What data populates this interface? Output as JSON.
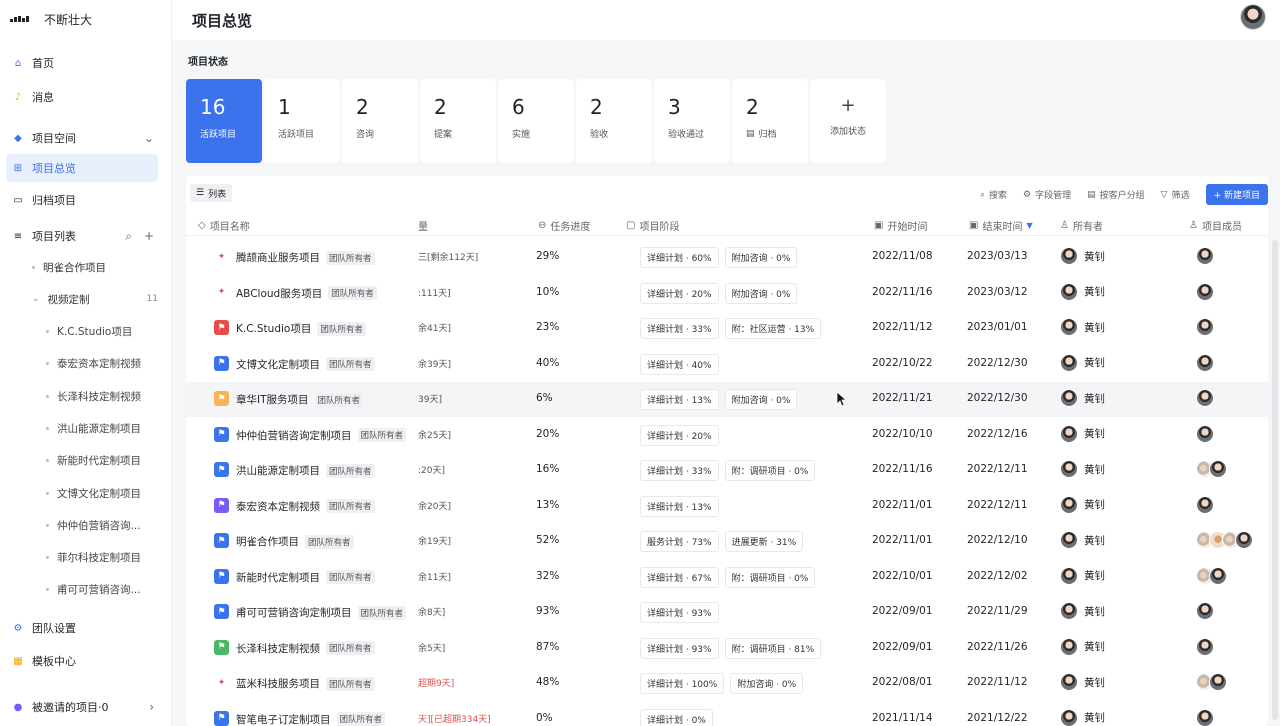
{
  "brand": {
    "name": "不断壮大"
  },
  "header": {
    "title": "项目总览"
  },
  "sidebar": {
    "home": "首页",
    "messages": "消息",
    "space": "项目空间",
    "overview": "项目总览",
    "archived": "归档项目",
    "list": "项目列表",
    "sub_items": [
      {
        "label": "明雀合作项目"
      },
      {
        "label": "视频定制",
        "count": "11"
      }
    ],
    "sub_sub_items": [
      "K.C.Studio项目",
      "泰宏资本定制视频",
      "长泽科技定制视频",
      "洪山能源定制项目",
      "新能时代定制项目",
      "文博文化定制项目",
      "仲仲伯营销咨询...",
      "菲尔科技定制项目",
      "甫可可营销咨询..."
    ],
    "team_settings": "团队设置",
    "templates": "模板中心",
    "invited": "被邀请的项目·0"
  },
  "status": {
    "title": "项目状态",
    "cards": [
      {
        "num": "16",
        "label": "活跃项目"
      },
      {
        "num": "1",
        "label": "活跃项目"
      },
      {
        "num": "2",
        "label": "咨询"
      },
      {
        "num": "2",
        "label": "提案"
      },
      {
        "num": "6",
        "label": "实施"
      },
      {
        "num": "2",
        "label": "验收"
      },
      {
        "num": "3",
        "label": "验收通过"
      },
      {
        "num": "2",
        "label": "归档"
      },
      {
        "num": "+",
        "label": "添加状态"
      }
    ]
  },
  "toolbar": {
    "list_tab": "列表",
    "search": "搜索",
    "fields": "字段管理",
    "group": "按客户分组",
    "filter": "筛选",
    "new": "+ 新建项目"
  },
  "table": {
    "headers": {
      "name": "项目名称",
      "remaining": "量",
      "progress": "任务进度",
      "phase": "项目阶段",
      "start": "开始时间",
      "end": "结束时间",
      "owner": "所有者",
      "members": "项目成员"
    },
    "tag": "团队所有者",
    "owner_name": "黄钊",
    "rows": [
      {
        "flag": "pin",
        "name": "腾颉商业服务项目",
        "remaining": "三[剩余112天]",
        "progress": "29%",
        "phases": [
          "详细计划 · 60%",
          "附加咨询 · 0%"
        ],
        "start": "2022/11/08",
        "end": "2023/03/13",
        "members": 1
      },
      {
        "flag": "pin",
        "name": "ABCloud服务项目",
        "remaining": ":111天]",
        "progress": "10%",
        "phases": [
          "详细计划 · 20%",
          "附加咨询 · 0%"
        ],
        "start": "2022/11/16",
        "end": "2023/03/12",
        "members": 1
      },
      {
        "flag": "red",
        "name": "K.C.Studio项目",
        "remaining": "余41天]",
        "progress": "23%",
        "phases": [
          "详细计划 · 33%",
          "附：社区运营 · 13%"
        ],
        "start": "2022/11/12",
        "end": "2023/01/01",
        "members": 1
      },
      {
        "flag": "blue",
        "name": "文博文化定制项目",
        "remaining": "余39天]",
        "progress": "40%",
        "phases": [
          "详细计划 · 40%"
        ],
        "start": "2022/10/22",
        "end": "2022/12/30",
        "members": 1
      },
      {
        "flag": "orange",
        "name": "章华IT服务项目",
        "remaining": "39天]",
        "progress": "6%",
        "phases": [
          "详细计划 · 13%",
          "附加咨询 · 0%"
        ],
        "start": "2022/11/21",
        "end": "2022/12/30",
        "members": 1
      },
      {
        "flag": "blue",
        "name": "仲仲伯营销咨询定制项目",
        "remaining": "余25天]",
        "progress": "20%",
        "phases": [
          "详细计划 · 20%"
        ],
        "start": "2022/10/10",
        "end": "2022/12/16",
        "members": 1
      },
      {
        "flag": "blue",
        "name": "洪山能源定制项目",
        "remaining": ":20天]",
        "progress": "16%",
        "phases": [
          "详细计划 · 33%",
          "附：调研项目 · 0%"
        ],
        "start": "2022/11/16",
        "end": "2022/12/11",
        "members": 2
      },
      {
        "flag": "purple",
        "name": "泰宏资本定制视频",
        "remaining": "余20天]",
        "progress": "13%",
        "phases": [
          "详细计划 · 13%"
        ],
        "start": "2022/11/01",
        "end": "2022/12/11",
        "members": 1
      },
      {
        "flag": "blue",
        "name": "明雀合作项目",
        "remaining": "余19天]",
        "progress": "52%",
        "phases": [
          "服务计划 · 73%",
          "进展更新 · 31%"
        ],
        "start": "2022/11/01",
        "end": "2022/12/10",
        "members": 4
      },
      {
        "flag": "blue",
        "name": "新能时代定制项目",
        "remaining": "余11天]",
        "progress": "32%",
        "phases": [
          "详细计划 · 67%",
          "附：调研项目 · 0%"
        ],
        "start": "2022/10/01",
        "end": "2022/12/02",
        "members": 2
      },
      {
        "flag": "blue",
        "name": "甫可可营销咨询定制项目",
        "remaining": "余8天]",
        "progress": "93%",
        "phases": [
          "详细计划 · 93%"
        ],
        "start": "2022/09/01",
        "end": "2022/11/29",
        "members": 1
      },
      {
        "flag": "green",
        "name": "长泽科技定制视频",
        "remaining": "余5天]",
        "progress": "87%",
        "phases": [
          "详细计划 · 93%",
          "附：调研项目 · 81%"
        ],
        "start": "2022/09/01",
        "end": "2022/11/26",
        "members": 1
      },
      {
        "flag": "pin",
        "name": "蓝米科技服务项目",
        "remaining": "超期9天]",
        "overdue": true,
        "progress": "48%",
        "phases": [
          "详细计划 · 100%",
          "附加咨询 · 0%"
        ],
        "start": "2022/08/01",
        "end": "2022/11/12",
        "members": 2
      },
      {
        "flag": "blue",
        "name": "智笔电子订定制项目",
        "remaining": "天][已超期334天]",
        "overdue": true,
        "progress": "0%",
        "phases": [
          "详细计划 · 0%"
        ],
        "start": "2021/11/14",
        "end": "2021/12/22",
        "members": 1
      }
    ]
  },
  "colors": {
    "accent": "#3b73ec",
    "overdue": "#e34d4d"
  }
}
